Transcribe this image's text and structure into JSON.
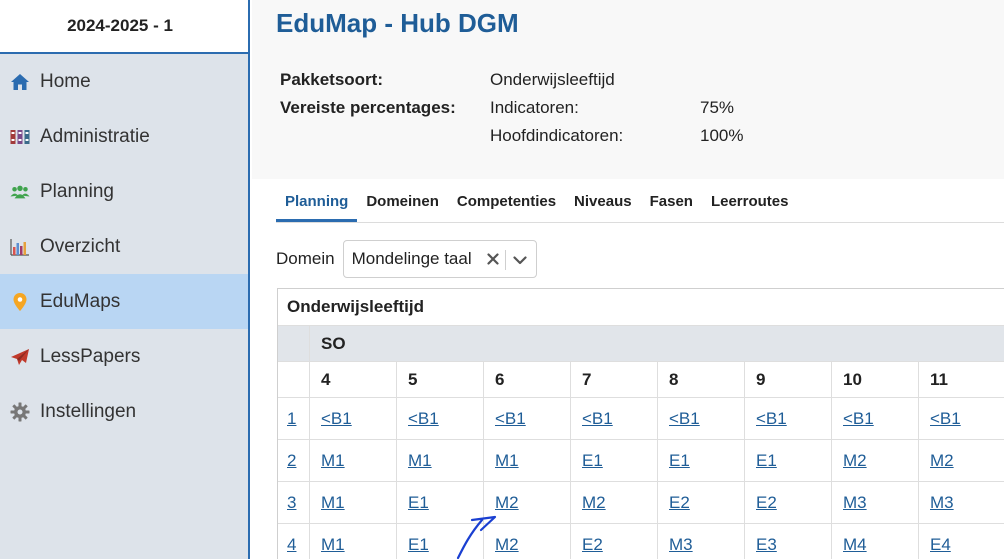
{
  "sidebar": {
    "term": "2024-2025 - 1",
    "items": [
      {
        "label": "Home",
        "icon": "home-icon",
        "color": "#2b6cb0"
      },
      {
        "label": "Administratie",
        "icon": "binders-icon",
        "color": "#a23a3a"
      },
      {
        "label": "Planning",
        "icon": "users-icon",
        "color": "#3fa34d"
      },
      {
        "label": "Overzicht",
        "icon": "bar-chart-icon",
        "color": "#a23a6a"
      },
      {
        "label": "EduMaps",
        "icon": "map-pin-icon",
        "color": "#f5a623",
        "active": true
      },
      {
        "label": "LessPapers",
        "icon": "paper-plane-icon",
        "color": "#c0392b"
      },
      {
        "label": "Instellingen",
        "icon": "gear-icon",
        "color": "#777777"
      }
    ]
  },
  "header": {
    "title": "EduMap - Hub DGM",
    "pakketsoort_label": "Pakketsoort:",
    "pakketsoort_value": "Onderwijsleeftijd",
    "vereiste_label": "Vereiste percentages:",
    "indicatoren_label": "Indicatoren:",
    "indicatoren_value": "75%",
    "hoofdindicatoren_label": "Hoofdindicatoren:",
    "hoofdindicatoren_value": "100%"
  },
  "tabs": [
    {
      "label": "Planning",
      "active": true
    },
    {
      "label": "Domeinen"
    },
    {
      "label": "Competenties"
    },
    {
      "label": "Niveaus"
    },
    {
      "label": "Fasen"
    },
    {
      "label": "Leerroutes"
    }
  ],
  "filter": {
    "domain_label": "Domein",
    "domain_value": "Mondelinge taal"
  },
  "table": {
    "title": "Onderwijsleeftijd",
    "group": "SO",
    "columns": [
      "4",
      "5",
      "6",
      "7",
      "8",
      "9",
      "10",
      "11"
    ],
    "rows": [
      {
        "index": "1",
        "cells": [
          "<B1",
          "<B1",
          "<B1",
          "<B1",
          "<B1",
          "<B1",
          "<B1",
          "<B1"
        ]
      },
      {
        "index": "2",
        "cells": [
          "M1",
          "M1",
          "M1",
          "E1",
          "E1",
          "E1",
          "M2",
          "M2"
        ]
      },
      {
        "index": "3",
        "cells": [
          "M1",
          "E1",
          "M2",
          "M2",
          "E2",
          "E2",
          "M3",
          "M3"
        ]
      },
      {
        "index": "4",
        "cells": [
          "M1",
          "E1",
          "M2",
          "E2",
          "M3",
          "E3",
          "M4",
          "E4"
        ]
      }
    ]
  },
  "colors": {
    "accent": "#2b6cb0",
    "title": "#1f5d97",
    "sidebar_bg": "#dde3ea",
    "sidebar_active": "#b9d6f3",
    "annotation_arrow": "#1a3fd1"
  }
}
